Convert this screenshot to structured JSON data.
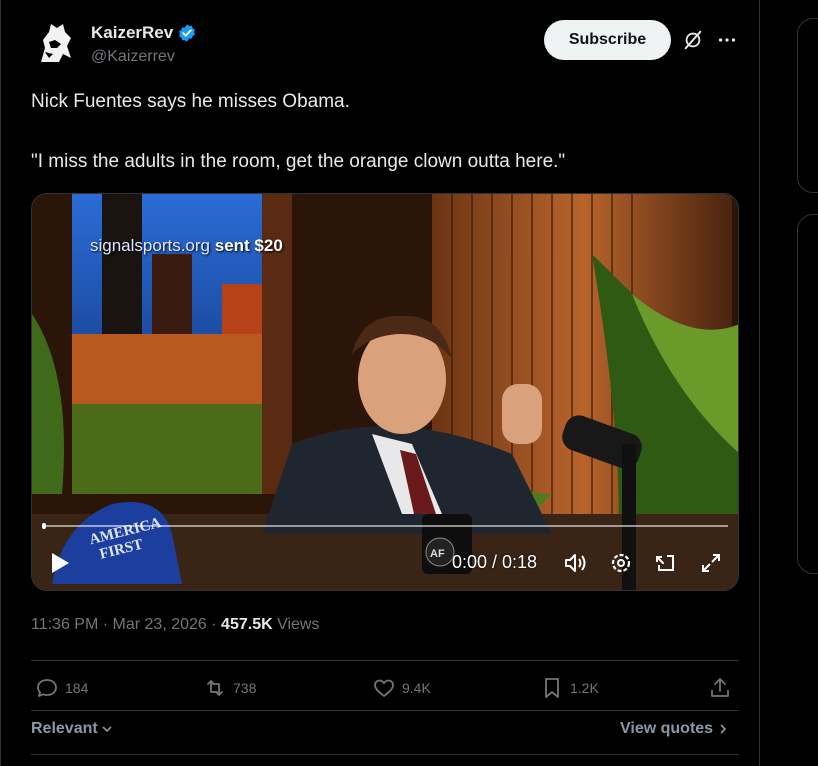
{
  "author": {
    "name": "KaizerRev",
    "handle": "@Kaizerrev",
    "verified_color": "#1d9bf0"
  },
  "header": {
    "subscribe_label": "Subscribe",
    "icons": [
      "grok-icon",
      "more-icon"
    ]
  },
  "tweet": {
    "line1": "Nick Fuentes says he misses Obama.",
    "line2": "\"I miss the adults in the room, get the orange clown outta here.\""
  },
  "video": {
    "overlay_site": "signalsports.org",
    "overlay_sent": "sent $20",
    "hat_line1": "AMERICA",
    "hat_line2": "FIRST",
    "mug_logo": "AF",
    "time": "0:00 / 0:18",
    "progress_fraction": 0.0
  },
  "meta": {
    "time": "11:36 PM",
    "date": "Mar 23, 2026",
    "views_count": "457.5K",
    "views_label": "Views"
  },
  "actions": {
    "replies": "184",
    "reposts": "738",
    "likes": "9.4K",
    "bookmarks": "1.2K"
  },
  "footer": {
    "sort_label": "Relevant",
    "quotes_label": "View quotes"
  },
  "colors": {
    "background": "#000000",
    "text": "#e7e9ea",
    "muted": "#71767b",
    "border": "#2f3336",
    "subscribe_bg": "#eff3f4"
  }
}
